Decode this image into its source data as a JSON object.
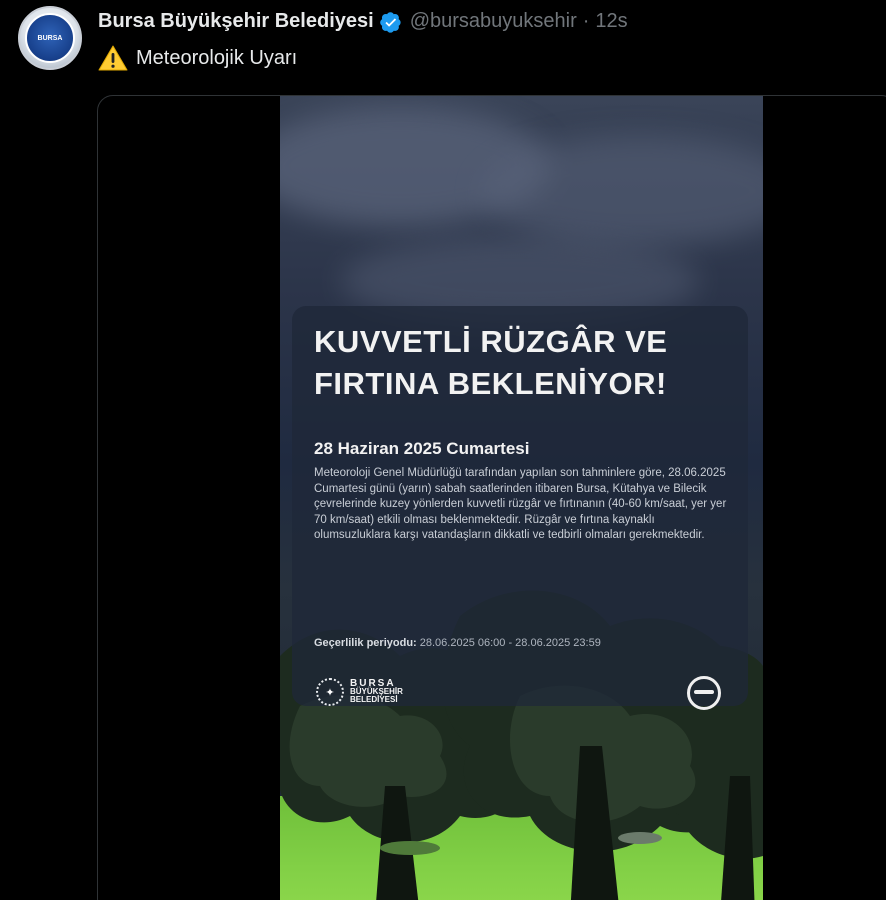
{
  "author": {
    "display_name": "Bursa Büyükşehir Belediyesi",
    "handle": "@bursabuyuksehir",
    "separator": "·",
    "time": "12s",
    "verified_icon": "verified-badge-icon",
    "avatar_text": "BURSA"
  },
  "tweet": {
    "emoji_icon": "warning-icon",
    "text": "Meteorolojik Uyarı"
  },
  "video": {
    "headline": "KUVVETLİ RÜZGÂR VE FIRTINA BEKLENİYOR!",
    "date": "28 Haziran 2025 Cumartesi",
    "body": "Meteoroloji Genel Müdürlüğü tarafından yapılan son tahminlere göre, 28.06.2025 Cumartesi günü (yarın) sabah saatlerinden itibaren Bursa, Kütahya ve Bilecik çevrelerinde kuzey yönlerden kuvvetli rüzgâr ve fırtınanın (40-60 km/saat, yer yer 70 km/saat) etkili olması beklenmektedir. Rüzgâr ve fırtına kaynaklı olumsuzluklara karşı vatandaşların dikkatli ve tedbirli olmaları gerekmektedir.",
    "validity_label": "Geçerlilik periyodu:",
    "validity_value": "28.06.2025  06:00  -  28.06.2025  23:59",
    "brand_line1": "BURSA",
    "brand_line2": "BÜYÜKŞEHİR",
    "brand_line3": "BELEDİYESİ"
  },
  "colors": {
    "background": "#000000",
    "text_primary": "#e7e9ea",
    "text_secondary": "#71767b",
    "verified_blue": "#1d9bf0",
    "warning_yellow": "#ffcc33"
  }
}
